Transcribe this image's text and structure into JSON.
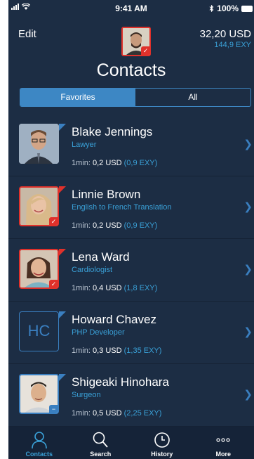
{
  "status": {
    "time": "9:41 AM",
    "battery": "100%",
    "signal_icon": "signal-bars-icon",
    "wifi_icon": "wifi-icon",
    "bluetooth_icon": "bluetooth-icon"
  },
  "header": {
    "edit_label": "Edit",
    "balance_usd": "32,20 USD",
    "balance_exy": "144,9 EXY",
    "title": "Contacts"
  },
  "segment": {
    "favorites": "Favorites",
    "all": "All",
    "selected": "Favorites"
  },
  "contacts": [
    {
      "name": "Blake Jennings",
      "role": "Lawyer",
      "rate_label": "1min:",
      "rate_usd": "0,2 USD",
      "rate_exy": "(0,9 EXY)"
    },
    {
      "name": "Linnie Brown",
      "role": "English to French Translation",
      "rate_label": "1min:",
      "rate_usd": "0,2 USD",
      "rate_exy": "(0,9 EXY)"
    },
    {
      "name": "Lena Ward",
      "role": "Cardiologist",
      "rate_label": "1min:",
      "rate_usd": "0,4 USD",
      "rate_exy": "(1,8 EXY)"
    },
    {
      "name": "Howard Chavez",
      "role": "PHP Developer",
      "rate_label": "1min:",
      "rate_usd": "0,3 USD",
      "rate_exy": "(1,35 EXY)",
      "initials": "HC"
    },
    {
      "name": "Shigeaki Hinohara",
      "role": "Surgeon",
      "rate_label": "1min:",
      "rate_usd": "0,5 USD",
      "rate_exy": "(2,25 EXY)"
    }
  ],
  "tabs": [
    {
      "label": "Contacts",
      "icon": "person-icon",
      "active": true
    },
    {
      "label": "Search",
      "icon": "search-icon"
    },
    {
      "label": "History",
      "icon": "clock-icon"
    },
    {
      "label": "More",
      "icon": "more-dots-icon"
    }
  ],
  "colors": {
    "background": "#1c2d44",
    "accent": "#3aa1d8",
    "red": "#e0312b",
    "tabbar": "#152338"
  }
}
